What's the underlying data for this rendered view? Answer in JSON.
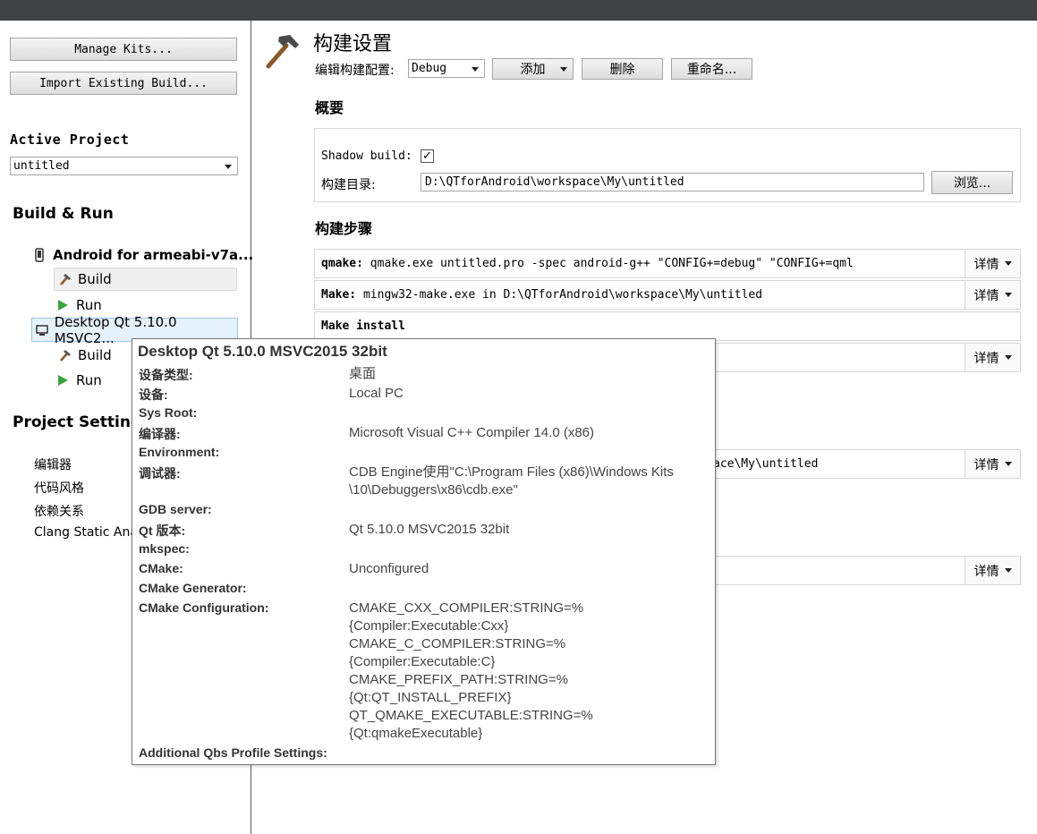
{
  "left": {
    "manage_kits": "Manage Kits...",
    "import_build": "Import Existing Build...",
    "active_project_label": "Active Project",
    "active_project_value": "untitled",
    "build_run_header": "Build & Run",
    "kit1_name": "Android for armeabi-v7a...",
    "kit1_build": "Build",
    "kit1_run": "Run",
    "kit2_name": "Desktop Qt 5.10.0 MSVC2...",
    "kit2_build": "Build",
    "kit2_run": "Run",
    "project_settings_header": "Project Settings",
    "ps_items": [
      "编辑器",
      "代码风格",
      "依赖关系",
      "Clang Static Analyzer"
    ]
  },
  "right": {
    "title": "构建设置",
    "edit_config_label": "编辑构建配置:",
    "config_value": "Debug",
    "add_label": "添加",
    "delete_label": "删除",
    "rename_label": "重命名...",
    "overview_header": "概要",
    "shadow_build_label": "Shadow build:",
    "shadow_build_checked": true,
    "build_dir_label": "构建目录:",
    "build_dir_value": "D:\\QTforAndroid\\workspace\\My\\untitled",
    "browse_label": "浏览...",
    "build_steps_header": "构建步骤",
    "detail_label": "详情",
    "steps": [
      {
        "key": "qmake:",
        "text": " qmake.exe untitled.pro -spec android-g++ \"CONFIG+=debug\" \"CONFIG+=qml"
      },
      {
        "key": "Make:",
        "text": " mingw32-make.exe in D:\\QTforAndroid\\workspace\\My\\untitled"
      },
      {
        "key": "Make install",
        "text": ""
      }
    ],
    "hidden_row_text": "ace\\My\\untitled"
  },
  "tooltip": {
    "title": "Desktop Qt 5.10.0 MSVC2015 32bit",
    "rows": [
      {
        "key": "设备类型:",
        "val": "桌面"
      },
      {
        "key": "设备:",
        "val": "Local PC"
      },
      {
        "key": "Sys Root:",
        "val": ""
      },
      {
        "key": "编译器:",
        "val": "Microsoft Visual C++ Compiler 14.0 (x86)"
      },
      {
        "key": "Environment:",
        "val": ""
      },
      {
        "key": "调试器:",
        "val": "CDB Engine使用\"C:\\Program Files (x86)\\Windows Kits"
      },
      {
        "key": "",
        "val": "\\10\\Debuggers\\x86\\cdb.exe\""
      },
      {
        "key": "GDB server:",
        "val": ""
      },
      {
        "key": "Qt 版本:",
        "val": "Qt 5.10.0 MSVC2015 32bit"
      },
      {
        "key": "mkspec:",
        "val": ""
      },
      {
        "key": "CMake:",
        "val": "Unconfigured"
      },
      {
        "key": "CMake Generator:",
        "val": ""
      },
      {
        "key": "CMake Configuration:",
        "val": "CMAKE_CXX_COMPILER:STRING=%"
      },
      {
        "key": "",
        "val": "{Compiler:Executable:Cxx}"
      },
      {
        "key": "",
        "val": "CMAKE_C_COMPILER:STRING=%"
      },
      {
        "key": "",
        "val": "{Compiler:Executable:C}"
      },
      {
        "key": "",
        "val": "CMAKE_PREFIX_PATH:STRING=%"
      },
      {
        "key": "",
        "val": "{Qt:QT_INSTALL_PREFIX}"
      },
      {
        "key": "",
        "val": "QT_QMAKE_EXECUTABLE:STRING=%"
      },
      {
        "key": "",
        "val": "{Qt:qmakeExecutable}"
      },
      {
        "key": "Additional Qbs Profile Settings:",
        "val": ""
      }
    ]
  }
}
